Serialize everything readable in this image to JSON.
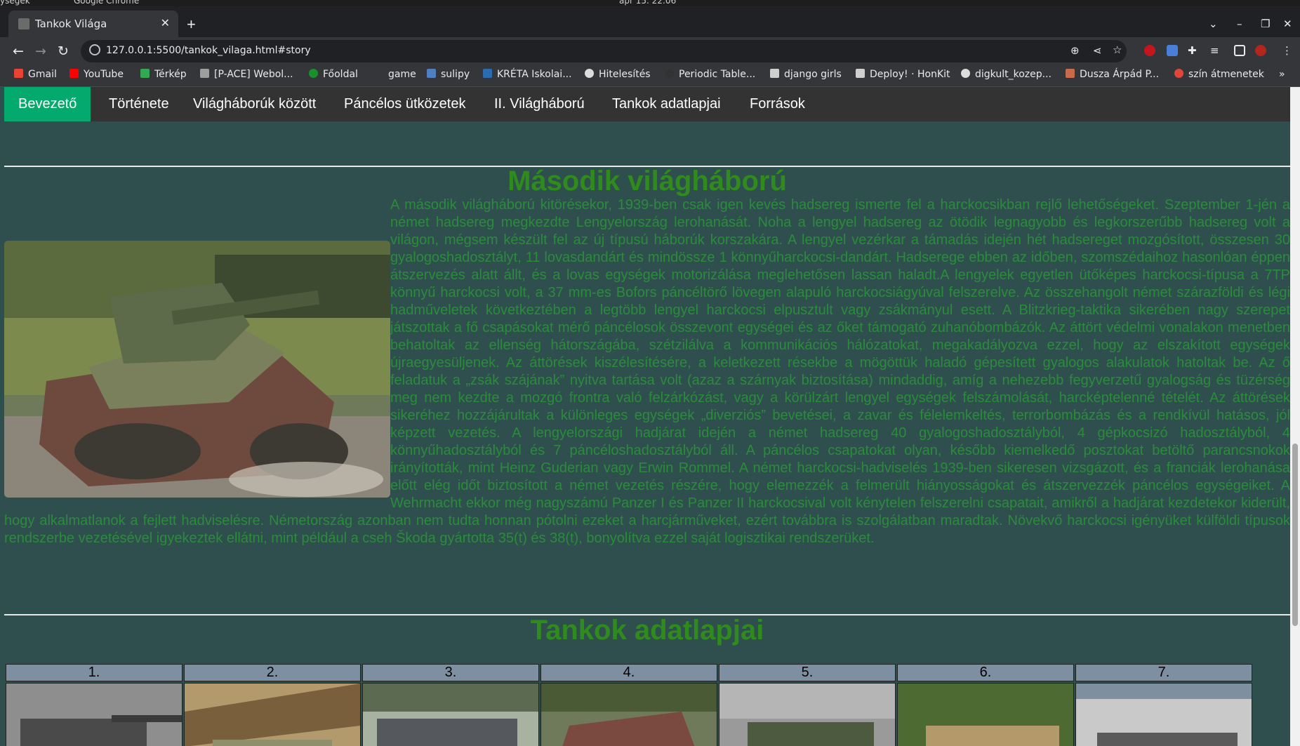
{
  "os": {
    "left_text": "ységek",
    "app_name": "Google Chrome",
    "clock": "ápr 15. 22:06"
  },
  "browser": {
    "tab_title": "Tankok Világa",
    "url": "127.0.0.1:5500/tankok_vilaga.html#story"
  },
  "bookmarks": [
    {
      "label": "Gmail",
      "color": "#ea4335"
    },
    {
      "label": "YouTube",
      "color": "#ff0000"
    },
    {
      "label": "Térkép",
      "color": "#34a853"
    },
    {
      "label": "[P-ACE] Webol...",
      "color": "#9e9e9e"
    },
    {
      "label": "Főoldal",
      "color": "#1a8f2c"
    },
    {
      "label": "game",
      "color": "#35363a"
    },
    {
      "label": "sulipy",
      "color": "#4f7fbf"
    },
    {
      "label": "KRÉTA Iskolai...",
      "color": "#2b6cb0"
    },
    {
      "label": "Hitelesítés",
      "color": "#dddddd"
    },
    {
      "label": "Periodic Table...",
      "color": "#333333"
    },
    {
      "label": "django girls",
      "color": "#cfcfcf"
    },
    {
      "label": "Deploy! · HonKit",
      "color": "#cfcfcf"
    },
    {
      "label": "digkult_kozep...",
      "color": "#dddddd"
    },
    {
      "label": "Dusza Árpád P...",
      "color": "#c96a4a"
    },
    {
      "label": "szín átmenetek",
      "color": "#e0453a"
    }
  ],
  "nav": [
    "Bevezető",
    "Története",
    "Világháborúk között",
    "Páncélos ütközetek",
    "II. Világháború",
    "Tankok adatlapjai",
    "Források"
  ],
  "section1": {
    "title": "Második világháború",
    "text": "A második világháború kitörésekor, 1939-ben csak igen kevés hadsereg ismerte fel a harckocsikban rejlő lehetőségeket. Szeptember 1-jén a német hadsereg megkezdte Lengyelország lerohanását. Noha a lengyel hadsereg az ötödik legnagyobb és legkorszerűbb hadsereg volt a világon, mégsem készült fel az új típusú háborúk korszakára. A lengyel vezérkar a támadás idején hét hadsereget mozgósított, összesen 30 gyalogoshadosztályt, 11 lovasdandárt és mindössze 1 könnyűharckocsi-dandárt. Hadserege ebben az időben, szomszédaihoz hasonlóan éppen átszervezés alatt állt, és a lovas egységek motorizálása meglehetősen lassan haladt.A lengyelek egyetlen ütőképes harckocsi-típusa a 7TP könnyű harckocsi volt, a 37 mm-es Bofors páncéltörő lövegen alapuló harckocsiágyúval felszerelve. Az összehangolt német szárazföldi és légi hadműveletek következtében a legtöbb lengyel harckocsi elpusztult vagy zsákmányul esett. A Blitzkrieg-taktika sikerében nagy szerepet játszottak a fő csapásokat mérő páncélosok összevont egységei és az őket támogató zuhanóbombázók. Az áttört védelmi vonalakon menetben behatoltak az ellenség hátországába, szétzilálva a kommunikációs hálózatokat, megakadályozva ezzel, hogy az elszakított egységek újraegyesüljenek. Az áttörések kiszélesítésére, a keletkezett résekbe a mögöttük haladó gépesített gyalogos alakulatok hatoltak be. Az ő feladatuk a „zsák szájának” nyitva tartása volt (azaz a szárnyak biztosítása) mindaddig, amíg a nehezebb fegyverzetű gyalogság és tüzérség meg nem kezdte a mozgó frontra való felzárkózást, vagy a körülzárt lengyel egységek felszámolását, harcképtelenné tételét. Az áttörések sikeréhez hozzájárultak a különleges egységek „diverziós” bevetései, a zavar és félelemkeltés, terrorbombázás és a rendkívül hatásos, jól képzett vezetés. A lengyelországi hadjárat idején a német hadsereg 40 gyalogoshadosztályból, 4 gépkocsizó hadosztályból, 4 könnyűhadosztályból és 7 páncéloshadosztályból áll. A páncélos csapatokat olyan, később kiemelkedő posztokat betöltő parancsnokok irányították, mint Heinz Guderian vagy Erwin Rommel. A német harckocsi-hadviselés 1939-ben sikeresen vizsgázott, és a franciák lerohanása előtt elég időt biztosított a német vezetés részére, hogy elemezzék a felmerült hiányosságokat és átszervezzék páncélos egységeiket. A Wehrmacht ekkor még nagyszámú Panzer I és Panzer II harckocsival volt kénytelen felszerelni csapatait, amikről a hadjárat kezdetekor kiderült, hogy alkalmatlanok a fejlett hadviselésre. Németország azonban nem tudta honnan pótolni ezeket a harcjárműveket, ezért továbbra is szolgálatban maradtak. Növekvő harckocsi igényüket külföldi típusok rendszerbe vezetésével igyekeztek ellátni, mint például a cseh Škoda gyártotta 35(t) és 38(t), bonyolítva ezzel saját logisztikai rendszerüket."
  },
  "section2": {
    "title": "Tankok adatlapjai",
    "columns": [
      "1.",
      "2.",
      "3.",
      "4.",
      "5.",
      "6.",
      "7."
    ]
  }
}
